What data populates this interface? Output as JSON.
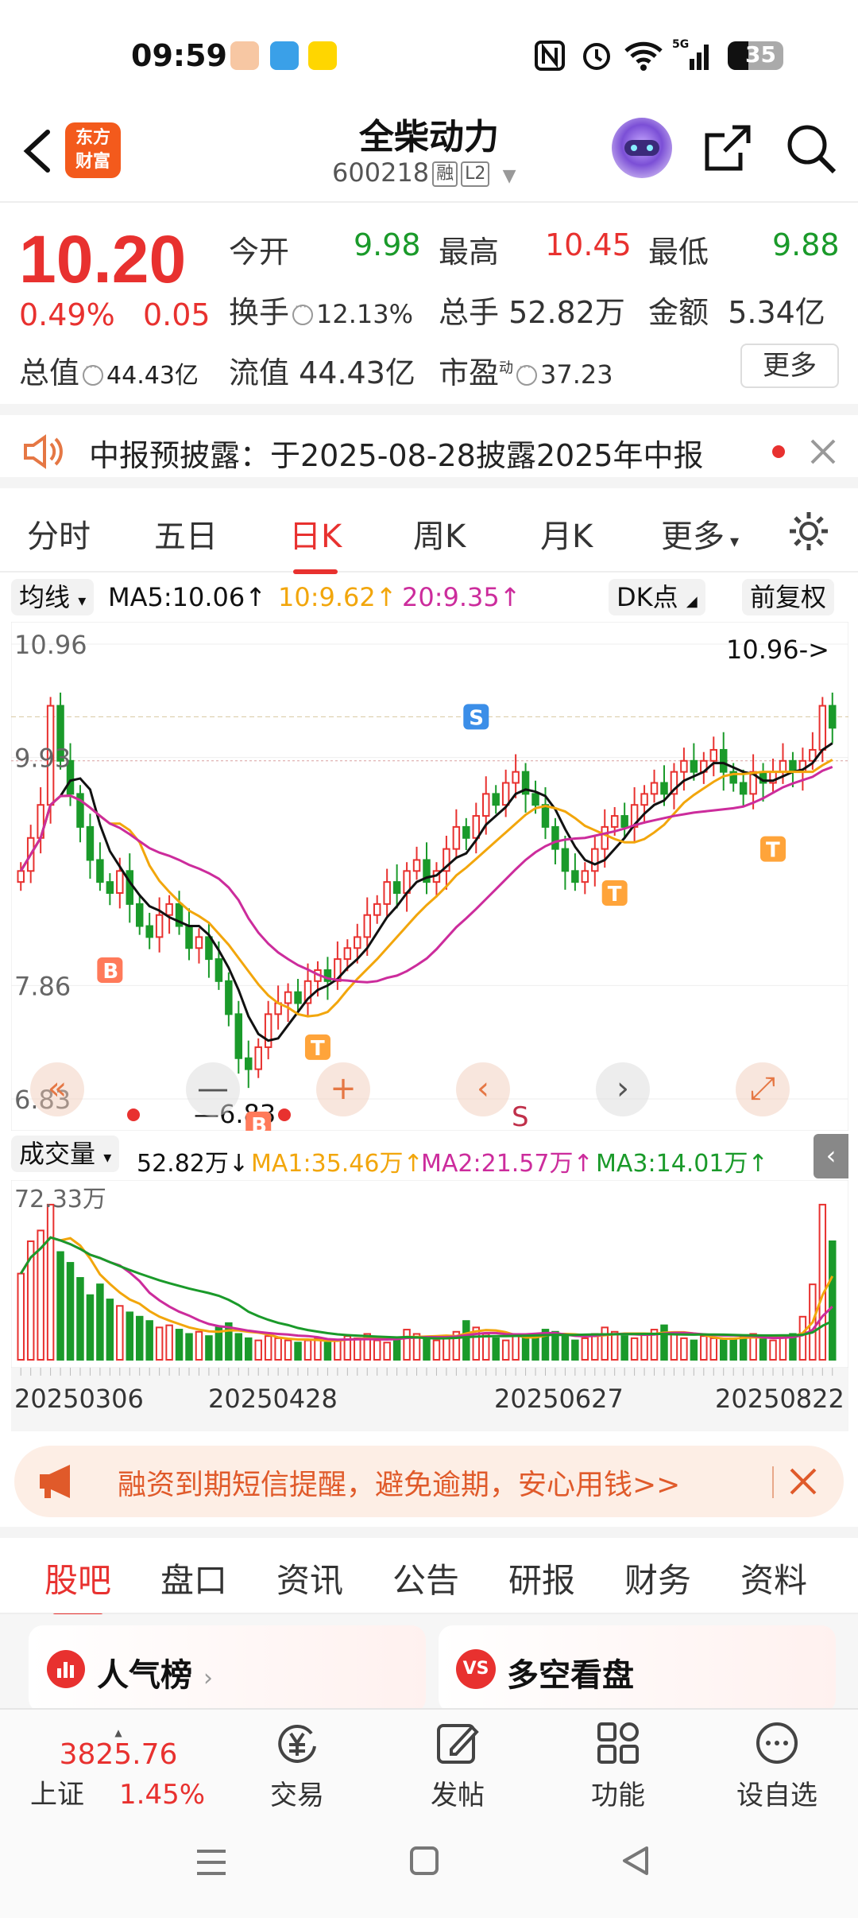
{
  "status": {
    "time": "09:59",
    "battery": "35",
    "signal": "5G"
  },
  "header": {
    "logo_line1": "东方",
    "logo_line2": "财富",
    "stock_name": "全柴动力",
    "stock_code": "600218",
    "tag_margin": "融",
    "tag_level": "L2"
  },
  "quote": {
    "price": "10.20",
    "change_pct": "0.49%",
    "change": "0.05",
    "open_label": "今开",
    "open": "9.98",
    "high_label": "最高",
    "high": "10.45",
    "low_label": "最低",
    "low": "9.88",
    "turnover_label": "换手",
    "turnover": "12.13%",
    "volume_label": "总手",
    "volume": "52.82万",
    "amount_label": "金额",
    "amount": "5.34亿",
    "mktcap_label": "总值",
    "mktcap": "44.43亿",
    "float_label": "流值",
    "float": "44.43亿",
    "pe_label": "市盈",
    "pe_sup": "动",
    "pe": "37.23",
    "more_button": "更多"
  },
  "notice": {
    "text": "中报预披露：于2025-08-28披露2025年中报"
  },
  "chart_tabs": [
    "分时",
    "五日",
    "日K",
    "周K",
    "月K",
    "更多"
  ],
  "active_tab": "日K",
  "ma_bar": {
    "selector": "均线",
    "ma5": "MA5:10.06",
    "ma10": "10:9.62",
    "ma20": "20:9.35",
    "dk_button": "DK点",
    "adjust_button": "前复权"
  },
  "chart_data": {
    "type": "candlestick",
    "y_ticks": [
      "10.96",
      "9.93",
      "7.86",
      "6.83"
    ],
    "ylim": [
      6.83,
      10.96
    ],
    "high_marker": "10.96->",
    "low_marker": "6.83",
    "signal_letter": "S",
    "x_labels": [
      "20250306",
      "20250428",
      "20250627",
      "20250822"
    ],
    "closes": [
      8.9,
      9.2,
      9.5,
      10.4,
      9.9,
      9.6,
      9.3,
      9.0,
      8.8,
      8.7,
      8.9,
      8.6,
      8.4,
      8.3,
      8.5,
      8.6,
      8.4,
      8.2,
      8.3,
      8.1,
      7.9,
      7.6,
      7.2,
      7.1,
      7.3,
      7.6,
      7.7,
      7.8,
      7.7,
      7.9,
      8.0,
      7.9,
      8.1,
      8.2,
      8.3,
      8.5,
      8.6,
      8.8,
      8.7,
      8.9,
      9.0,
      8.8,
      8.9,
      9.1,
      9.3,
      9.2,
      9.4,
      9.6,
      9.5,
      9.7,
      9.8,
      9.6,
      9.5,
      9.3,
      9.1,
      8.9,
      8.8,
      8.9,
      9.1,
      9.3,
      9.4,
      9.3,
      9.5,
      9.6,
      9.7,
      9.6,
      9.8,
      9.9,
      9.8,
      9.9,
      10.0,
      9.8,
      9.7,
      9.6,
      9.8,
      9.7,
      9.8,
      9.9,
      9.8,
      9.9,
      10.0,
      10.4,
      10.2
    ],
    "volume": {
      "label": "成交量",
      "current": "52.82万",
      "ma1": "MA1:35.46万",
      "ma2": "MA2:21.57万",
      "ma3": "MA3:14.01万",
      "max_label": "72.33万",
      "values": [
        40,
        55,
        60,
        72,
        50,
        45,
        38,
        30,
        35,
        28,
        25,
        22,
        20,
        18,
        15,
        16,
        14,
        12,
        13,
        11,
        15,
        17,
        12,
        10,
        9,
        11,
        10,
        9,
        8,
        9,
        10,
        8,
        9,
        11,
        10,
        12,
        9,
        8,
        10,
        14,
        12,
        10,
        9,
        11,
        13,
        18,
        15,
        12,
        10,
        9,
        11,
        10,
        12,
        14,
        13,
        11,
        9,
        10,
        12,
        15,
        13,
        11,
        10,
        12,
        14,
        16,
        12,
        10,
        9,
        11,
        10,
        9,
        10,
        11,
        12,
        10,
        9,
        11,
        12,
        20,
        35,
        72,
        55
      ]
    }
  },
  "chart_controls": [
    "«",
    "—",
    "+",
    "‹",
    "›",
    "⤢"
  ],
  "promo": {
    "text": "融资到期短信提醒，避免逾期，安心用钱>>"
  },
  "bottom_tabs": [
    "股吧",
    "盘口",
    "资讯",
    "公告",
    "研报",
    "财务",
    "资料"
  ],
  "active_bottom_tab": "股吧",
  "cards": {
    "left_title": "人气榜",
    "right_title": "多空看盘",
    "right_badge": "VS"
  },
  "bottom_nav": {
    "index_value": "3825.76",
    "index_name": "上证",
    "index_change": "1.45%",
    "trade": "交易",
    "post": "发帖",
    "function": "功能",
    "watchlist": "设自选"
  },
  "colors": {
    "up": "#e8312f",
    "down": "#1a9a2a",
    "ma5": "#111111",
    "ma10": "#f2a60c",
    "ma20": "#cc2c9c",
    "accent": "#f35a1c"
  }
}
